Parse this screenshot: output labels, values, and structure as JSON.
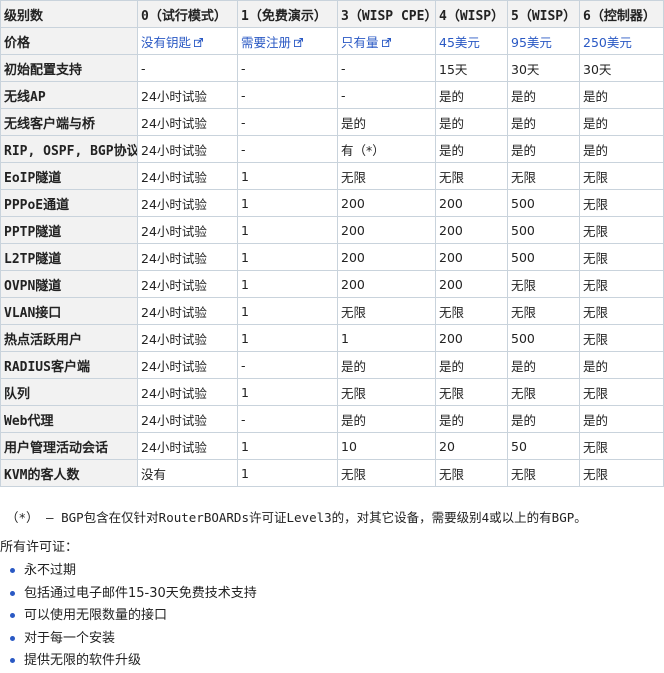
{
  "table": {
    "headers": [
      "级别数",
      "0（试行模式）",
      "1（免费演示）",
      "3（WISP CPE）",
      "4（WISP）",
      "5（WISP）",
      "6（控制器）"
    ],
    "price_row": {
      "label": "价格",
      "cells": [
        {
          "text": "没有钥匙",
          "link": true,
          "external": true
        },
        {
          "text": "需要注册",
          "link": true,
          "external": true
        },
        {
          "text": "只有量",
          "link": true,
          "external": true
        },
        {
          "text": "45美元",
          "link": true,
          "external": false
        },
        {
          "text": "95美元",
          "link": true,
          "external": false
        },
        {
          "text": "250美元",
          "link": true,
          "external": false
        }
      ]
    },
    "rows": [
      {
        "label": "初始配置支持",
        "cells": [
          "-",
          "-",
          "-",
          "15天",
          "30天",
          "30天"
        ]
      },
      {
        "label": "无线AP",
        "cells": [
          "24小时试验",
          "-",
          "-",
          "是的",
          "是的",
          "是的"
        ]
      },
      {
        "label": "无线客户端与桥",
        "cells": [
          "24小时试验",
          "-",
          "是的",
          "是的",
          "是的",
          "是的"
        ]
      },
      {
        "label": "RIP, OSPF, BGP协议",
        "cells": [
          "24小时试验",
          "-",
          "有（*）",
          "是的",
          "是的",
          "是的"
        ]
      },
      {
        "label": "EoIP隧道",
        "cells": [
          "24小时试验",
          "1",
          "无限",
          "无限",
          "无限",
          "无限"
        ]
      },
      {
        "label": "PPPoE通道",
        "cells": [
          "24小时试验",
          "1",
          "200",
          "200",
          "500",
          "无限"
        ]
      },
      {
        "label": "PPTP隧道",
        "cells": [
          "24小时试验",
          "1",
          "200",
          "200",
          "500",
          "无限"
        ]
      },
      {
        "label": "L2TP隧道",
        "cells": [
          "24小时试验",
          "1",
          "200",
          "200",
          "500",
          "无限"
        ]
      },
      {
        "label": "OVPN隧道",
        "cells": [
          "24小时试验",
          "1",
          "200",
          "200",
          "无限",
          "无限"
        ]
      },
      {
        "label": "VLAN接口",
        "cells": [
          "24小时试验",
          "1",
          "无限",
          "无限",
          "无限",
          "无限"
        ]
      },
      {
        "label": "热点活跃用户",
        "cells": [
          "24小时试验",
          "1",
          "1",
          "200",
          "500",
          "无限"
        ]
      },
      {
        "label": "RADIUS客户端",
        "cells": [
          "24小时试验",
          "-",
          "是的",
          "是的",
          "是的",
          "是的"
        ]
      },
      {
        "label": "队列",
        "cells": [
          "24小时试验",
          "1",
          "无限",
          "无限",
          "无限",
          "无限"
        ]
      },
      {
        "label": "Web代理",
        "cells": [
          "24小时试验",
          "-",
          "是的",
          "是的",
          "是的",
          "是的"
        ]
      },
      {
        "label": "用户管理活动会话",
        "cells": [
          "24小时试验",
          "1",
          "10",
          "20",
          "50",
          "无限"
        ]
      },
      {
        "label": "KVM的客人数",
        "cells": [
          "没有",
          "1",
          "无限",
          "无限",
          "无限",
          "无限"
        ]
      }
    ]
  },
  "footnote": "（*） – BGP包含在仅针对RouterBOARDs许可证Level3的，对其它设备，需要级别4或以上的有BGP。",
  "all_licenses": {
    "heading": "所有许可证：",
    "items": [
      "永不过期",
      "包括通过电子邮件15-30天免费技术支持",
      "可以使用无限数量的接口",
      "对于每一个安装",
      "提供无限的软件升级"
    ]
  },
  "colors": {
    "link": "#2a59c4",
    "header_bg": "#f2f2f2",
    "border": "#c9d3dc",
    "bullet": "#2a59c4"
  },
  "icons": {
    "external_link": "external-link-icon",
    "bullet": "bullet-icon"
  }
}
